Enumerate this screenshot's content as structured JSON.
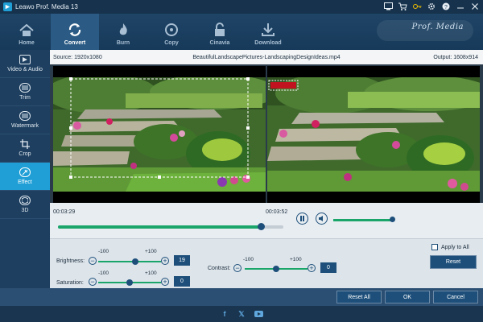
{
  "app": {
    "title": "Leawo Prof. Media 13",
    "brand": "Prof. Media"
  },
  "topnav": {
    "items": [
      {
        "label": "Home",
        "icon": "home-icon"
      },
      {
        "label": "Convert",
        "icon": "convert-icon",
        "active": true
      },
      {
        "label": "Burn",
        "icon": "burn-icon"
      },
      {
        "label": "Copy",
        "icon": "copy-icon"
      },
      {
        "label": "Cinavia",
        "icon": "cinavia-icon"
      },
      {
        "label": "Download",
        "icon": "download-icon"
      }
    ]
  },
  "sidebar": {
    "items": [
      {
        "label": "Video & Audio",
        "icon": "video-audio-icon"
      },
      {
        "label": "Trim",
        "icon": "trim-icon"
      },
      {
        "label": "Watermark",
        "icon": "watermark-icon"
      },
      {
        "label": "Crop",
        "icon": "crop-icon"
      },
      {
        "label": "Effect",
        "icon": "effect-icon",
        "active": true
      },
      {
        "label": "3D",
        "icon": "3d-icon"
      }
    ]
  },
  "info": {
    "source": "Source: 1920x1080",
    "filename": "BeautifulLandscapePictures-LandscapingDesignIdeas.mp4",
    "output": "Output: 1608x914"
  },
  "playback": {
    "start": "00:03:29",
    "end": "00:03:52",
    "position": 0.9,
    "volume": 1.0
  },
  "effects": {
    "brightness": {
      "label": "Brightness:",
      "min": "-100",
      "max": "+100",
      "value": "19"
    },
    "saturation": {
      "label": "Saturation:",
      "min": "-100",
      "max": "+100",
      "value": "0"
    },
    "contrast": {
      "label": "Contrast:",
      "min": "-100",
      "max": "+100",
      "value": "0"
    },
    "apply_all": "Apply to All",
    "reset": "Reset"
  },
  "actions": {
    "reset_all": "Reset All",
    "ok": "OK",
    "cancel": "Cancel"
  },
  "colors": {
    "accent": "#1f9fd6",
    "progress": "#1aa66a",
    "button": "#1d4f7a"
  }
}
